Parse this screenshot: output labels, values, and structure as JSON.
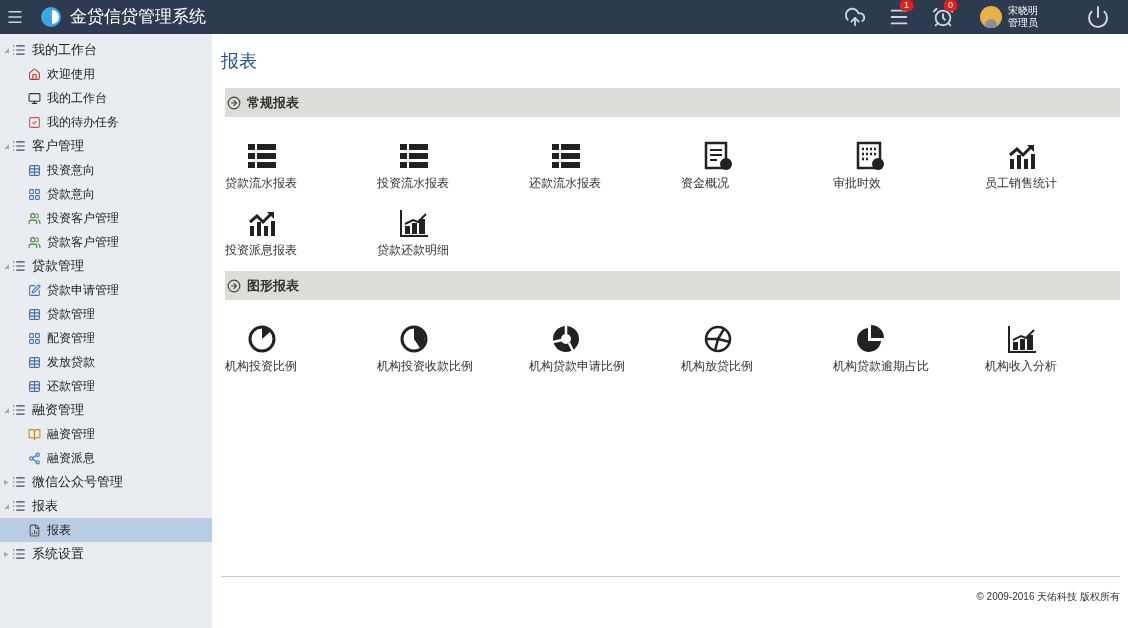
{
  "header": {
    "title": "金贷信贷管理系统",
    "badges": [
      {
        "kind": "list",
        "count": "1"
      },
      {
        "kind": "clock",
        "count": "0"
      }
    ],
    "user": {
      "name": "宋晓明",
      "role": "管理员"
    }
  },
  "sidebar": {
    "groups": [
      {
        "label": "我的工作台",
        "expanded": true,
        "children": [
          {
            "label": "欢迎使用",
            "kind": "home",
            "selected": false
          },
          {
            "label": "我的工作台",
            "kind": "monitor",
            "selected": false
          },
          {
            "label": "我的待办任务",
            "kind": "task",
            "selected": false
          }
        ]
      },
      {
        "label": "客户管理",
        "expanded": true,
        "children": [
          {
            "label": "投资意向",
            "kind": "table",
            "selected": false
          },
          {
            "label": "贷款意向",
            "kind": "grid",
            "selected": false
          },
          {
            "label": "投资客户管理",
            "kind": "users",
            "selected": false
          },
          {
            "label": "贷款客户管理",
            "kind": "users",
            "selected": false
          }
        ]
      },
      {
        "label": "贷款管理",
        "expanded": true,
        "children": [
          {
            "label": "贷款申请管理",
            "kind": "edit",
            "selected": false
          },
          {
            "label": "贷款管理",
            "kind": "table",
            "selected": false
          },
          {
            "label": "配资管理",
            "kind": "grid",
            "selected": false
          },
          {
            "label": "发放贷款",
            "kind": "table",
            "selected": false
          },
          {
            "label": "还款管理",
            "kind": "table",
            "selected": false
          }
        ]
      },
      {
        "label": "融资管理",
        "expanded": true,
        "children": [
          {
            "label": "融资管理",
            "kind": "book",
            "selected": false
          },
          {
            "label": "融资派息",
            "kind": "share",
            "selected": false
          }
        ]
      },
      {
        "label": "微信公众号管理",
        "expanded": false
      },
      {
        "label": "报表",
        "expanded": true,
        "children": [
          {
            "label": "报表",
            "kind": "report",
            "selected": true
          }
        ]
      },
      {
        "label": "系统设置",
        "expanded": false
      }
    ]
  },
  "page": {
    "title": "报表",
    "sections": [
      {
        "title": "常规报表",
        "items": [
          {
            "label": "贷款流水报表",
            "kind": "list"
          },
          {
            "label": "投资流水报表",
            "kind": "list"
          },
          {
            "label": "还款流水报表",
            "kind": "list"
          },
          {
            "label": "资金概况",
            "kind": "doc"
          },
          {
            "label": "审批时效",
            "kind": "calc"
          },
          {
            "label": "员工销售统计",
            "kind": "trend"
          },
          {
            "label": "投资派息报表",
            "kind": "trend"
          },
          {
            "label": "贷款还款明细",
            "kind": "bars"
          }
        ]
      },
      {
        "title": "图形报表",
        "items": [
          {
            "label": "机构投资比例",
            "kind": "pie1"
          },
          {
            "label": "机构投资收款比例",
            "kind": "pie2"
          },
          {
            "label": "机构贷款申请比例",
            "kind": "pie3"
          },
          {
            "label": "机构放贷比例",
            "kind": "pie4"
          },
          {
            "label": "机构贷款逾期占比",
            "kind": "pie5"
          },
          {
            "label": "机构收入分析",
            "kind": "bars"
          }
        ]
      }
    ]
  },
  "footer": "© 2009-2016 天佑科技 版权所有"
}
